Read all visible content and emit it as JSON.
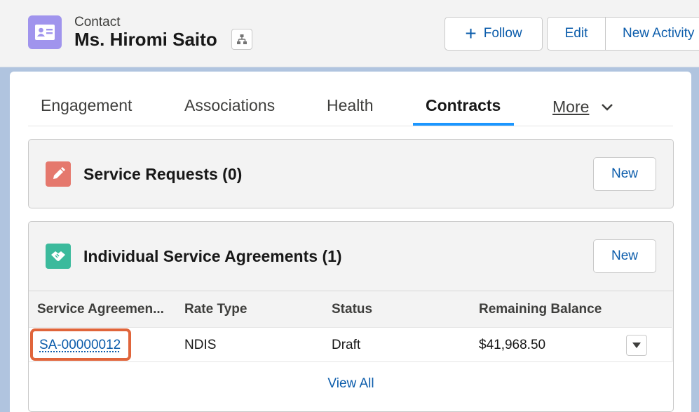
{
  "header": {
    "object_type": "Contact",
    "record_name": "Ms. Hiromi Saito",
    "icon": "contact-card-icon",
    "buttons": {
      "follow": "Follow",
      "edit": "Edit",
      "new_activity": "New Activity"
    }
  },
  "tabs": [
    {
      "label": "Engagement"
    },
    {
      "label": "Associations"
    },
    {
      "label": "Health"
    },
    {
      "label": "Contracts",
      "active": true
    },
    {
      "label": "More"
    }
  ],
  "service_requests": {
    "title": "Service Requests (0)",
    "icon": "pencil-icon",
    "new_label": "New"
  },
  "agreements": {
    "title": "Individual Service Agreements (1)",
    "icon": "handshake-icon",
    "new_label": "New",
    "columns": [
      "Service Agreemen...",
      "Rate Type",
      "Status",
      "Remaining Balance"
    ],
    "rows": [
      {
        "name": "SA-00000012",
        "rate_type": "NDIS",
        "status": "Draft",
        "balance": "$41,968.50"
      }
    ],
    "view_all": "View All"
  },
  "colors": {
    "brand_blue": "#0b5cab",
    "tab_underline": "#1b96ff",
    "contact_icon": "#a094ed",
    "pencil_icon": "#e5786d",
    "handshake_icon": "#3bba9c",
    "highlight": "#e0653b"
  }
}
